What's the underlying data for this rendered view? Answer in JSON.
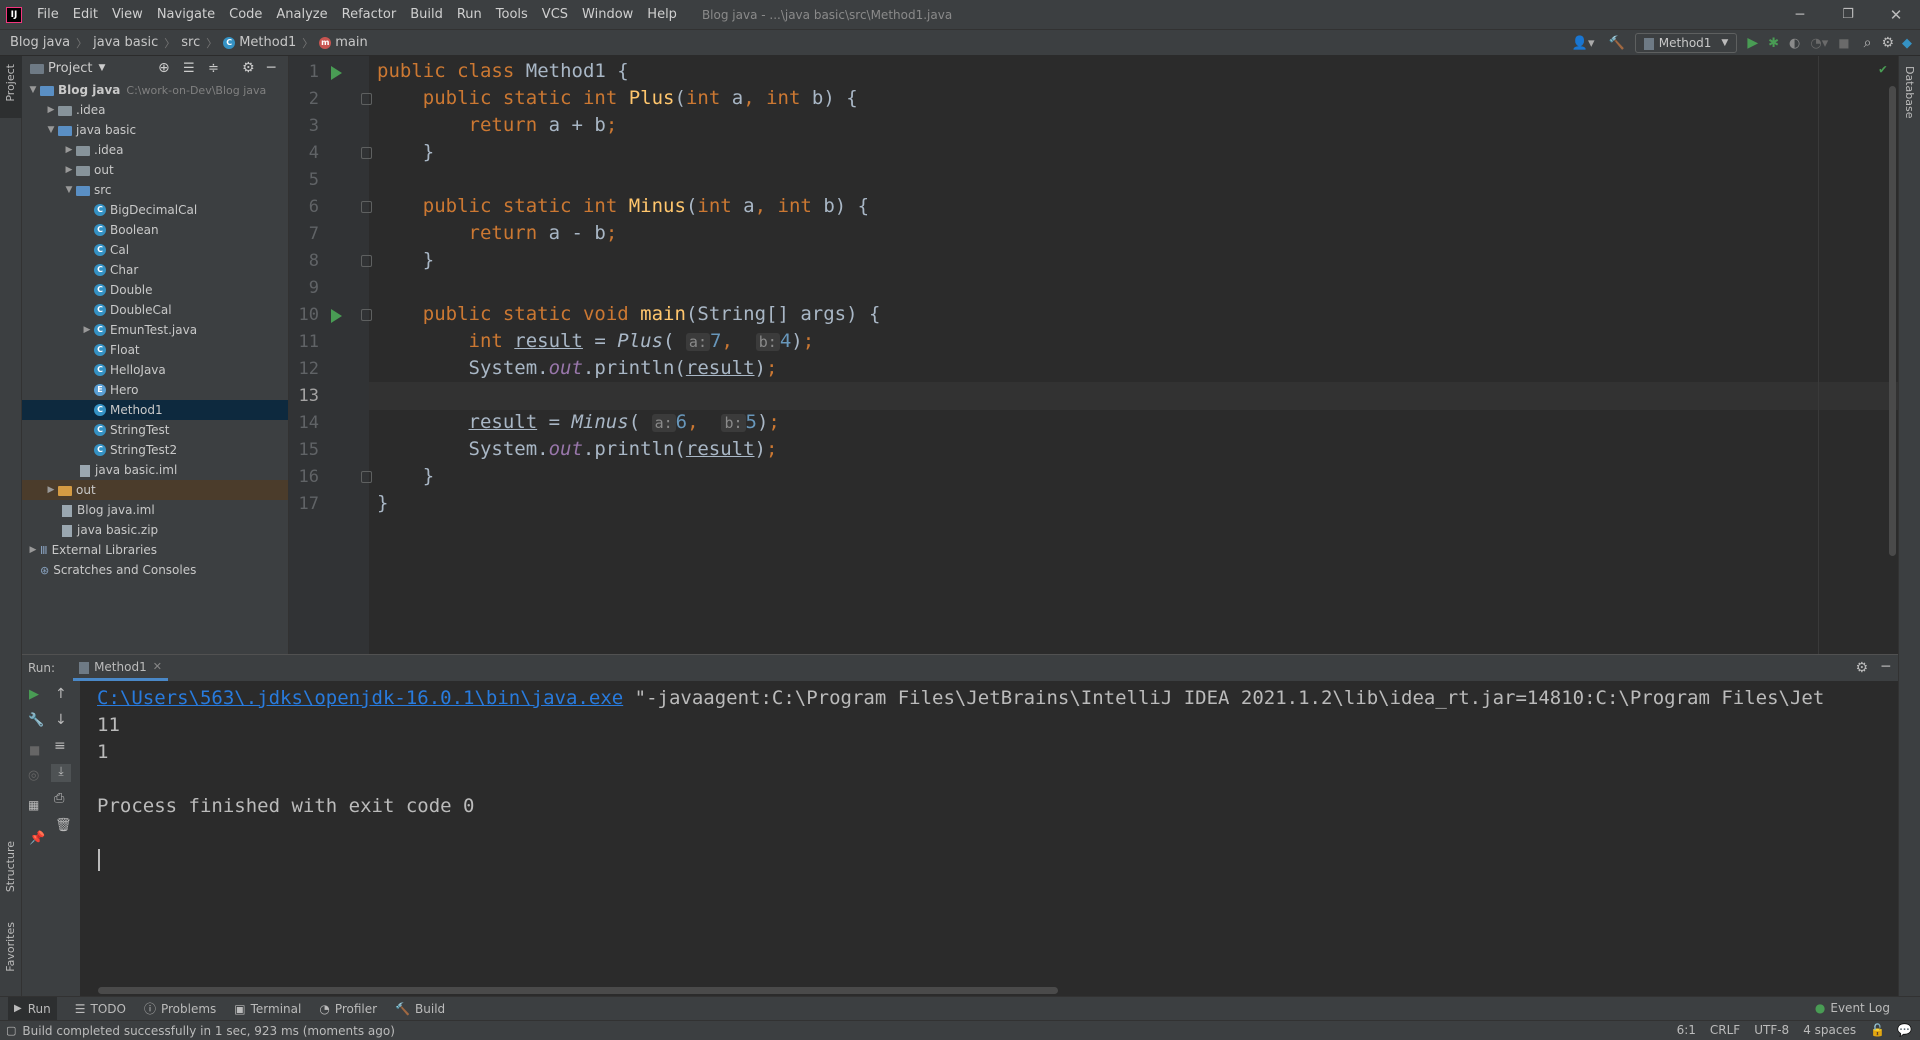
{
  "window": {
    "title": "Blog java - ...\\java basic\\src\\Method1.java",
    "menu": [
      "File",
      "Edit",
      "View",
      "Navigate",
      "Code",
      "Analyze",
      "Refactor",
      "Build",
      "Run",
      "Tools",
      "VCS",
      "Window",
      "Help"
    ]
  },
  "breadcrumb": [
    "Blog java",
    "java basic",
    "src",
    "Method1",
    "main"
  ],
  "toolbar": {
    "run_config": "Method1"
  },
  "project": {
    "header": "Project",
    "root_name": "Blog java",
    "root_path": "C:\\work-on-Dev\\Blog java",
    "items": [
      {
        "label": ".idea"
      },
      {
        "label": "java basic"
      },
      {
        "label": ".idea"
      },
      {
        "label": "out"
      },
      {
        "label": "src"
      },
      {
        "label": "BigDecimalCal"
      },
      {
        "label": "Boolean"
      },
      {
        "label": "Cal"
      },
      {
        "label": "Char"
      },
      {
        "label": "Double"
      },
      {
        "label": "DoubleCal"
      },
      {
        "label": "EmunTest.java"
      },
      {
        "label": "Float"
      },
      {
        "label": "HelloJava"
      },
      {
        "label": "Hero"
      },
      {
        "label": "Method1"
      },
      {
        "label": "StringTest"
      },
      {
        "label": "StringTest2"
      },
      {
        "label": "java basic.iml"
      },
      {
        "label": "out"
      },
      {
        "label": "Blog java.iml"
      },
      {
        "label": "java basic.zip"
      },
      {
        "label": "External Libraries"
      },
      {
        "label": "Scratches and Consoles"
      }
    ]
  },
  "editor": {
    "line_numbers": [
      "1",
      "2",
      "3",
      "4",
      "5",
      "6",
      "7",
      "8",
      "9",
      "10",
      "11",
      "12",
      "13",
      "14",
      "15",
      "16",
      "17"
    ],
    "current_line": 13,
    "tokens": {
      "public": "public",
      "static": "static",
      "int": "int",
      "class": "class",
      "return": "return",
      "void": "void",
      "Method1": "Method1",
      "Plus": "Plus",
      "Minus": "Minus",
      "main": "main",
      "a": "a",
      "b": "b",
      "args": "args",
      "String": "String[]",
      "result": "result",
      "System": "System.",
      "out": "out",
      "println": ".println(",
      "hint_a": "a:",
      "hint_b": "b:",
      "n7": "7",
      "n4": "4",
      "n6": "6",
      "n5": "5"
    }
  },
  "run": {
    "label": "Run:",
    "tab": "Method1",
    "java_path": "C:\\Users\\563\\.jdks\\openjdk-16.0.1\\bin\\java.exe",
    "cmd_rest": " \"-javaagent:C:\\Program Files\\JetBrains\\IntelliJ IDEA 2021.1.2\\lib\\idea_rt.jar=14810:C:\\Program Files\\Jet",
    "output": [
      "11",
      "1"
    ],
    "finished": "Process finished with exit code 0"
  },
  "bottom_tabs": [
    "Run",
    "TODO",
    "Problems",
    "Terminal",
    "Profiler",
    "Build"
  ],
  "event_log": "Event Log",
  "status": {
    "message": "Build completed successfully in 1 sec, 923 ms (moments ago)",
    "position": "6:1",
    "line_sep": "CRLF",
    "encoding": "UTF-8",
    "indent": "4 spaces"
  },
  "side_tabs": {
    "project": "Project",
    "structure": "Structure",
    "favorites": "Favorites",
    "database": "Database"
  },
  "colors": {
    "keyword": "#cc7832",
    "function": "#ffc66d",
    "number": "#6897bb",
    "static_field": "#9876aa",
    "link": "#287bde",
    "run_green": "#499c54"
  }
}
